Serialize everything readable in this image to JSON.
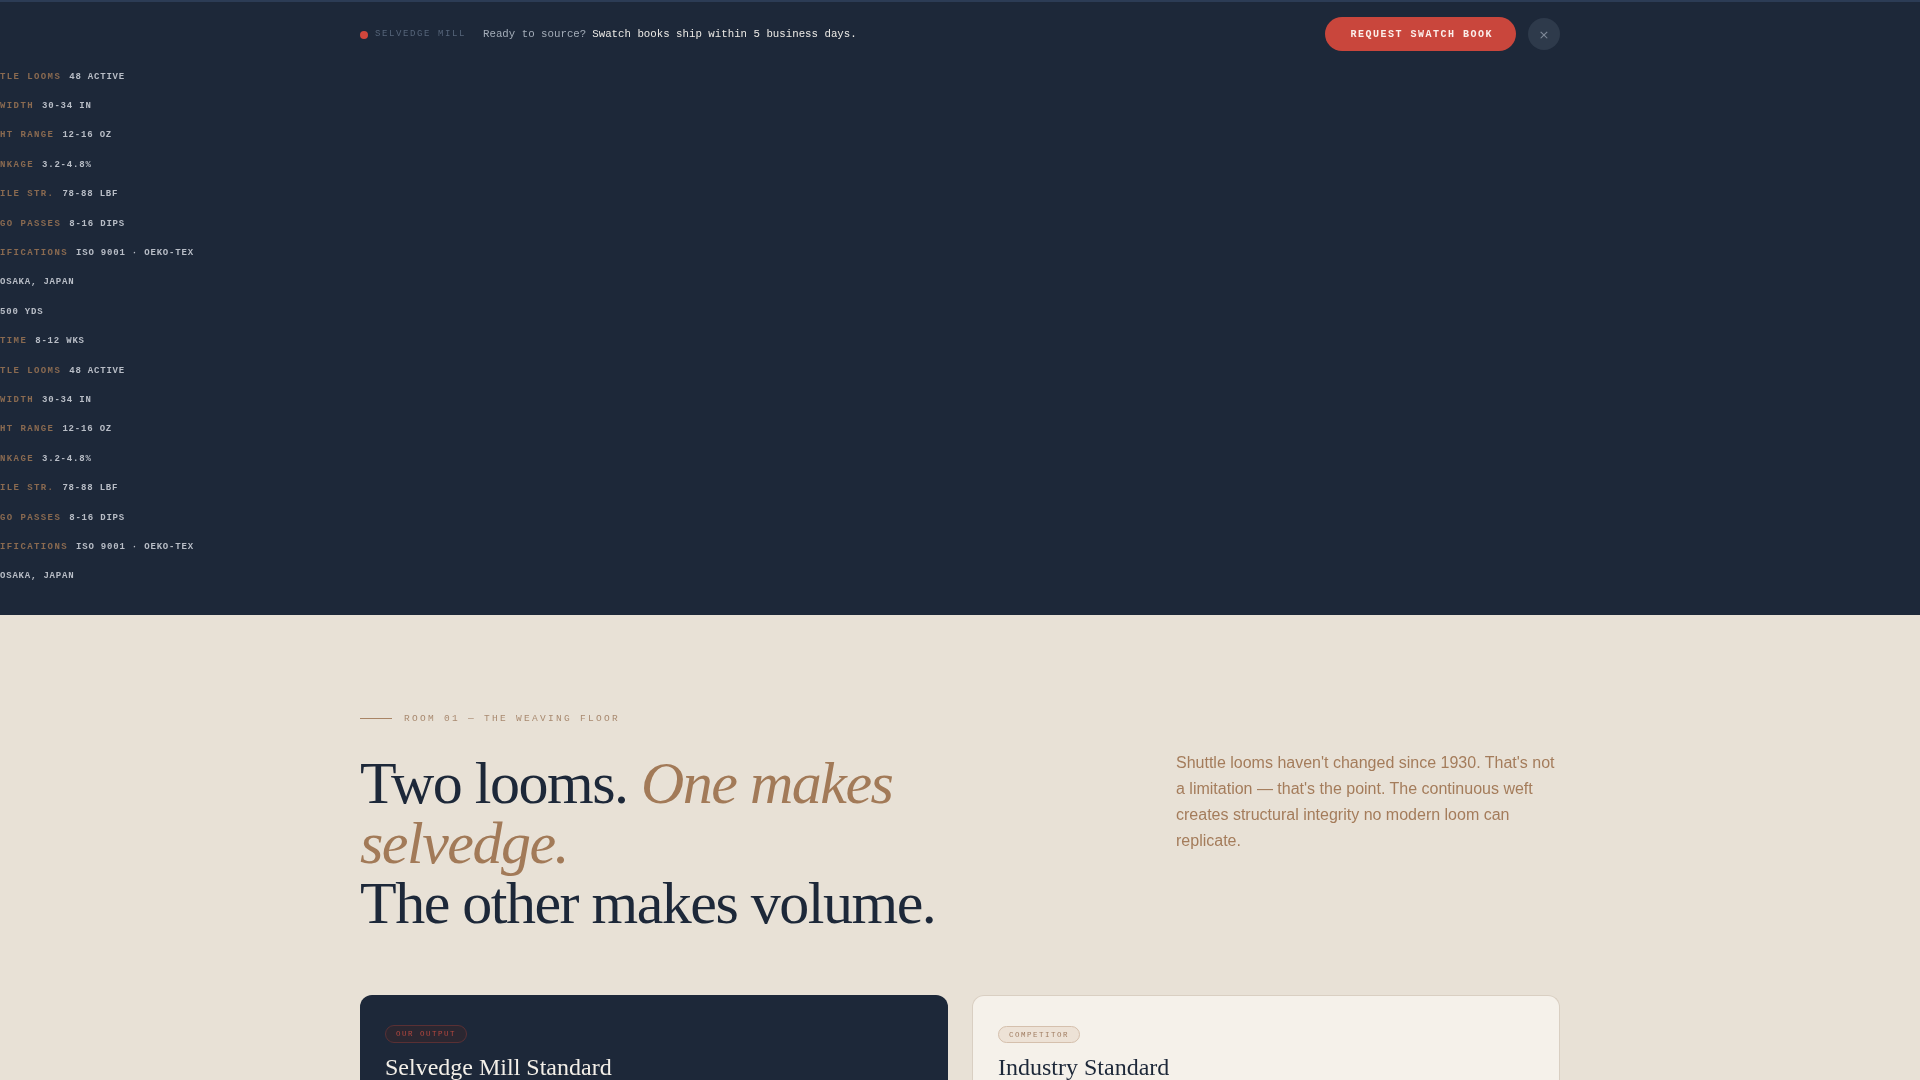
{
  "banner": {
    "brand": "SELVEDGE MILL",
    "prompt": "Ready to source?",
    "message": "Swatch books ship within 5 business days.",
    "cta": "REQUEST SWATCH BOOK",
    "close": "×"
  },
  "ticker": [
    {
      "label": "TLE LOOMS",
      "value": "48 ACTIVE"
    },
    {
      "label": "WIDTH",
      "value": "30-34 IN"
    },
    {
      "label": "HT RANGE",
      "value": "12-16 OZ"
    },
    {
      "label": "NKAGE",
      "value": "3.2-4.8%"
    },
    {
      "label": "ILE STR.",
      "value": "78-88 LBF"
    },
    {
      "label": "GO PASSES",
      "value": "8-16 DIPS"
    },
    {
      "label": "IFICATIONS",
      "value": "ISO 9001 · OEKO-TEX"
    },
    {
      "value": "OSAKA, JAPAN"
    },
    {
      "value": "500 YDS"
    },
    {
      "label": "TIME",
      "value": "8-12 WKS"
    },
    {
      "label": "TLE LOOMS",
      "value": "48 ACTIVE"
    },
    {
      "label": "WIDTH",
      "value": "30-34 IN"
    },
    {
      "label": "HT RANGE",
      "value": "12-16 OZ"
    },
    {
      "label": "NKAGE",
      "value": "3.2-4.8%"
    },
    {
      "label": "ILE STR.",
      "value": "78-88 LBF"
    },
    {
      "label": "GO PASSES",
      "value": "8-16 DIPS"
    },
    {
      "label": "IFICATIONS",
      "value": "ISO 9001 · OEKO-TEX"
    },
    {
      "value": "OSAKA, JAPAN"
    }
  ],
  "section": {
    "eyebrow": "ROOM 01 — THE WEAVING FLOOR",
    "heading": [
      "Two looms. *One makes selvedge.*",
      "The other makes volume."
    ],
    "intro": "Shuttle looms haven't changed since 1930. That's not a limitation — that's the point. The continuous weft creates structural integrity no modern loom can replicate."
  },
  "cards": [
    {
      "kind": "ours",
      "badge": "OUR OUTPUT",
      "title": "Selvedge Mill Standard"
    },
    {
      "kind": "competitor",
      "badge": "COMPETITOR",
      "title": "Industry Standard"
    }
  ]
}
